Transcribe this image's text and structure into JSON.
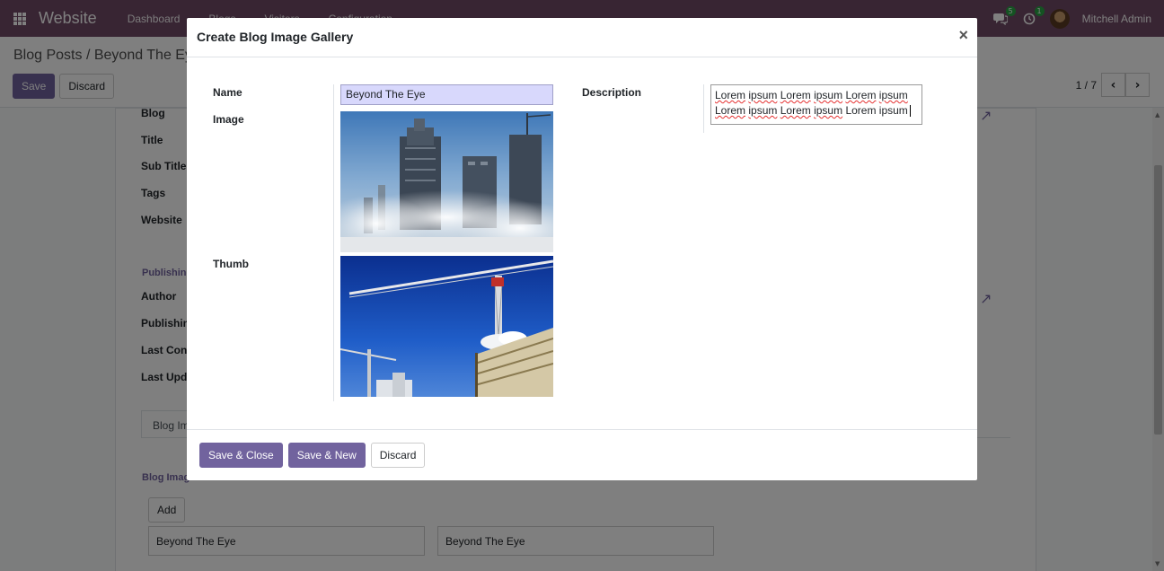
{
  "navbar": {
    "brand": "Website",
    "menu": [
      "Dashboard",
      "Blogs",
      "Visitors",
      "Configuration"
    ],
    "messages_badge": "5",
    "activity_badge": "1",
    "user_name": "Mitchell Admin"
  },
  "control_panel": {
    "breadcrumb_parent": "Blog Posts",
    "breadcrumb_sep": "/",
    "breadcrumb_current": "Beyond The Eye",
    "save_label": "Save",
    "discard_label": "Discard",
    "pager": "1 / 7"
  },
  "sheet": {
    "labels": {
      "blog": "Blog",
      "title": "Title",
      "subtitle": "Sub Title",
      "tags": "Tags",
      "website": "Website",
      "publishing_section": "Publishing",
      "author": "Author",
      "publishing_date": "Publishin",
      "last_contributor": "Last Con",
      "last_updated": "Last Upd"
    },
    "tab_label": "Blog Im",
    "gallery_section": "Blog Imag",
    "add_label": "Add",
    "gallery_items": [
      "Beyond The Eye",
      "Beyond The Eye"
    ]
  },
  "modal": {
    "title": "Create Blog Image Gallery",
    "close_glyph": "×",
    "labels": {
      "name": "Name",
      "image": "Image",
      "thumb": "Thumb",
      "description": "Description"
    },
    "name_value": "Beyond The Eye",
    "description_lines": [
      [
        "Lorem",
        "ipsum",
        "Lorem",
        "ipsum",
        "Lorem",
        "ipsum"
      ],
      [
        "Lorem",
        "ipsum",
        "Lorem",
        "ipsum",
        "Lorem ipsum"
      ]
    ],
    "buttons": {
      "save_close": "Save & Close",
      "save_new": "Save & New",
      "discard": "Discard"
    }
  },
  "colors": {
    "navbar": "#714b67",
    "primary": "#71639e",
    "name_input_bg": "#d8d8fc"
  },
  "icons": {
    "apps": "apps-grid-icon",
    "chat": "chat-icon",
    "activity": "clock-icon",
    "prev": "chevron-left-icon",
    "next": "chevron-right-icon",
    "external": "external-link-icon"
  }
}
